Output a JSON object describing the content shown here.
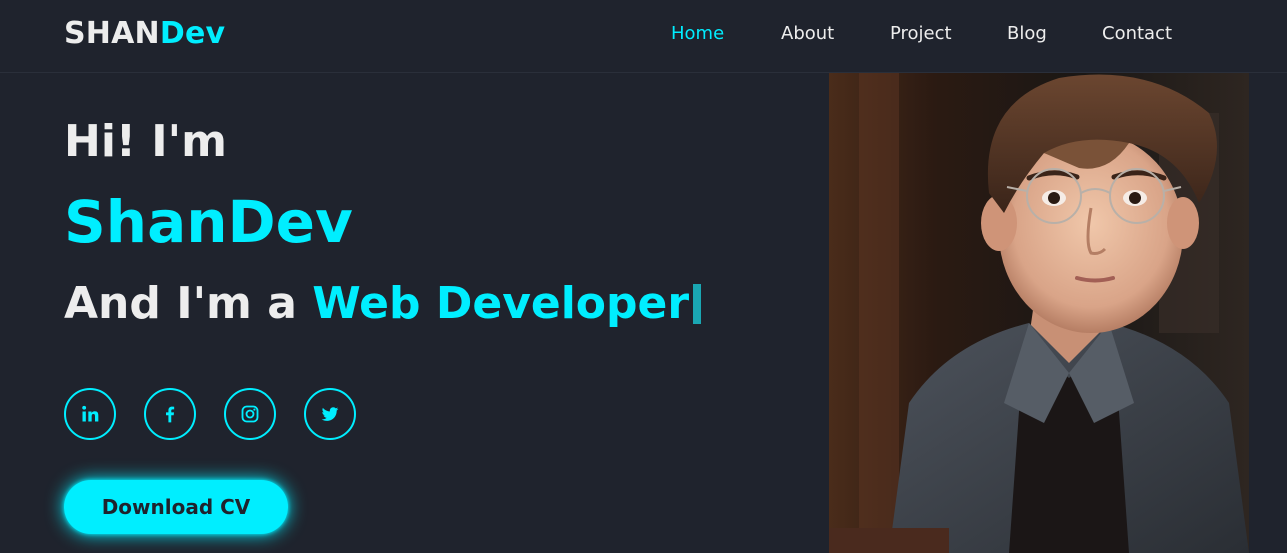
{
  "header": {
    "logo_part1": "SHAN",
    "logo_part2": "Dev",
    "nav": [
      {
        "label": "Home",
        "active": true
      },
      {
        "label": "About",
        "active": false
      },
      {
        "label": "Project",
        "active": false
      },
      {
        "label": "Blog",
        "active": false
      },
      {
        "label": "Contact",
        "active": false
      }
    ]
  },
  "hero": {
    "greeting": "Hi! I'm",
    "name": "ShanDev",
    "role_prefix": "And I'm a ",
    "role_highlight": "Web Developer",
    "social": [
      {
        "icon": "linkedin-icon"
      },
      {
        "icon": "facebook-icon"
      },
      {
        "icon": "instagram-icon"
      },
      {
        "icon": "twitter-icon"
      }
    ],
    "button_label": "Download CV"
  },
  "colors": {
    "background": "#1f232d",
    "accent": "#00eeff",
    "text": "#ededed"
  }
}
